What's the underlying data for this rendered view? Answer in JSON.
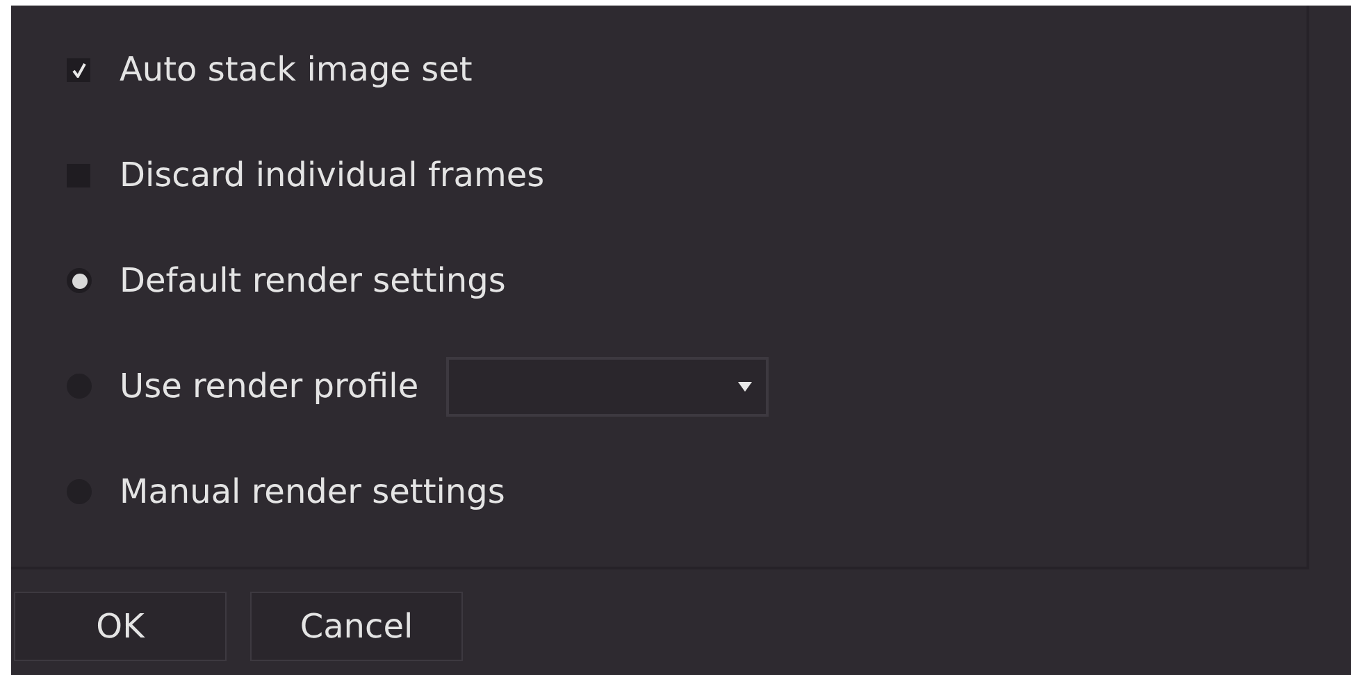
{
  "options": [
    {
      "kind": "checkbox",
      "label": "Auto stack image set",
      "checked": true
    },
    {
      "kind": "checkbox",
      "label": "Discard individual frames",
      "checked": false
    },
    {
      "kind": "radio",
      "label": "Default render settings",
      "selected": true
    },
    {
      "kind": "radio",
      "label": "Use render profile",
      "selected": false,
      "dropdown": true
    },
    {
      "kind": "radio",
      "label": "Manual render settings",
      "selected": false
    }
  ],
  "buttons": [
    "OK",
    "Cancel"
  ]
}
